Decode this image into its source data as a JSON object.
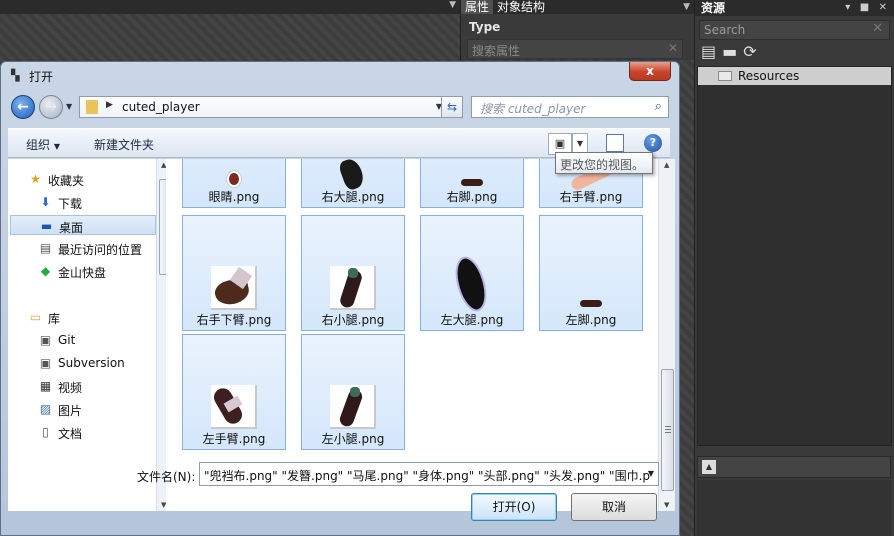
{
  "ide": {
    "properties_tab": "属性",
    "structure_tab": "对象结构",
    "type_label": "Type",
    "prop_search_placeholder": "搜索属性",
    "resources_title": "资源",
    "res_search_placeholder": "Search",
    "res_tree_item": "Resources"
  },
  "dialog": {
    "title": "打开",
    "close_label": "x",
    "address_path": "cuted_player",
    "search_placeholder": "搜索 cuted_player",
    "toolbar": {
      "organize": "组织",
      "new_folder": "新建文件夹"
    },
    "tooltip": "更改您的视图。",
    "nav": {
      "favorites": "收藏夹",
      "downloads": "下载",
      "desktop": "桌面",
      "recent": "最近访问的位置",
      "kingsoft": "金山快盘",
      "libraries": "库",
      "git": "Git",
      "subversion": "Subversion",
      "videos": "视频",
      "pictures": "图片",
      "documents": "文档"
    },
    "files": [
      {
        "name": "眼睛.png"
      },
      {
        "name": "右大腿.png"
      },
      {
        "name": "右脚.png"
      },
      {
        "name": "右手臂.png"
      },
      {
        "name": "右手下臂.png"
      },
      {
        "name": "右小腿.png"
      },
      {
        "name": "左大腿.png"
      },
      {
        "name": "左脚.png"
      },
      {
        "name": "左手臂.png"
      },
      {
        "name": "左小腿.png"
      }
    ],
    "filename_label": "文件名(N):",
    "filename_value": "\"兜裆布.png\" \"发簪.png\" \"马尾.png\" \"身体.png\" \"头部.png\" \"头发.png\" \"围巾.p",
    "open_button": "打开(O)",
    "cancel_button": "取消"
  }
}
